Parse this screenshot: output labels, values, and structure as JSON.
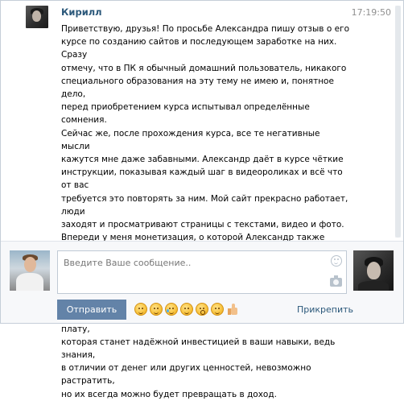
{
  "message": {
    "sender": "Кирилл",
    "time": "17:19:50",
    "text": "Приветствую, друзья! По просьбе Александра пишу отзыв о его\nкурсе по созданию сайтов и последующем заработке на них. Сразу\nотмечу, что в ПК я обычный домашний пользователь, никакого\nспециального образования на эту тему не имею и, понятное дело,\nперед приобретением курса испытывал определённые сомнения.\nСейчас же, после прохождения курса, все те негативные мысли\nкажутся мне даже забавными. Александр даёт в курсе чёткие\nинструкции, показывая каждый шаг в видеороликах и всё что от вас\nтребуется это повторять за ним. Мой сайт прекрасно работает, люди\nзаходят и просматривают страницы с текстами, видео и фото.\nВпереди у меня монетизация, о которой Александр также подробно\nрассказывает и я убеждён, что моя дальнейшая упорная работа над\nконтентом сайта и оптимизации его для поисковиков неизбежно\nприведёт к раскрутке и прибыли. И всё это за небольшую плату,\nкоторая станет надёжной инвестицией в ваши навыки, ведь знания,\nв отличии от денег или других ценностей, невозможно растратить,\nно их всегда можно будет превращать в доход."
  },
  "composer": {
    "placeholder": "Введите Ваше сообщение..",
    "send_label": "Отправить",
    "attach_label": "Прикрепить",
    "emoji_icons": [
      "smile-emoji",
      "laughing-emoji",
      "tears-of-joy-emoji",
      "weary-emoji",
      "astonished-emoji",
      "winking-emoji",
      "thumbs-up-emoji"
    ]
  },
  "colors": {
    "link": "#2b587a",
    "send_button": "#6383a8",
    "timestamp": "#8f8f8f",
    "composer_bg": "#f7f8fa",
    "border": "#c0cad5"
  }
}
